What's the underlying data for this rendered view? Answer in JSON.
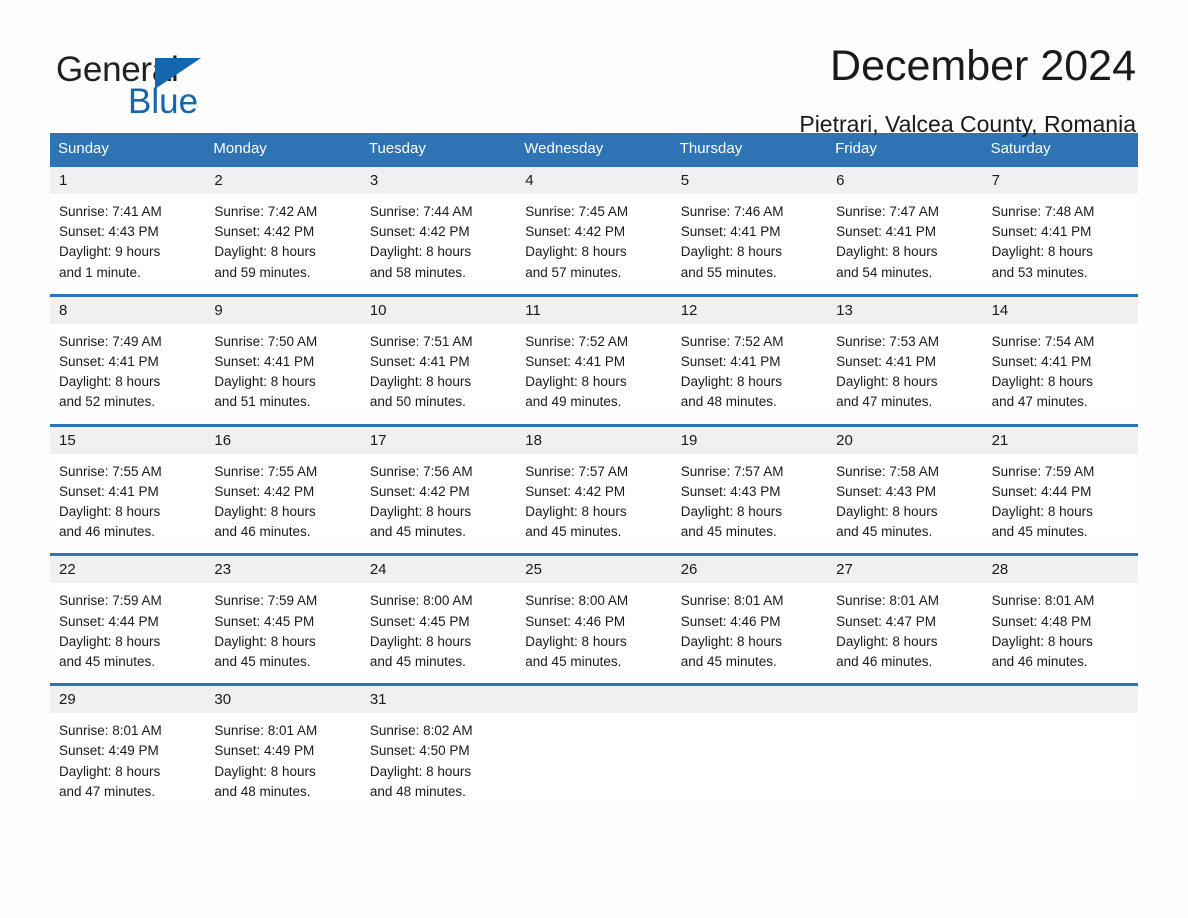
{
  "brand": {
    "name_part1": "General",
    "name_part2": "Blue",
    "triangle_color": "#1567ad",
    "accent_color": "#2e74b5"
  },
  "header": {
    "title": "December 2024",
    "location": "Pietrari, Valcea County, Romania"
  },
  "weekdays": [
    "Sunday",
    "Monday",
    "Tuesday",
    "Wednesday",
    "Thursday",
    "Friday",
    "Saturday"
  ],
  "weeks": [
    [
      {
        "day": "1",
        "lines": [
          "Sunrise: 7:41 AM",
          "Sunset: 4:43 PM",
          "Daylight: 9 hours",
          "and 1 minute."
        ]
      },
      {
        "day": "2",
        "lines": [
          "Sunrise: 7:42 AM",
          "Sunset: 4:42 PM",
          "Daylight: 8 hours",
          "and 59 minutes."
        ]
      },
      {
        "day": "3",
        "lines": [
          "Sunrise: 7:44 AM",
          "Sunset: 4:42 PM",
          "Daylight: 8 hours",
          "and 58 minutes."
        ]
      },
      {
        "day": "4",
        "lines": [
          "Sunrise: 7:45 AM",
          "Sunset: 4:42 PM",
          "Daylight: 8 hours",
          "and 57 minutes."
        ]
      },
      {
        "day": "5",
        "lines": [
          "Sunrise: 7:46 AM",
          "Sunset: 4:41 PM",
          "Daylight: 8 hours",
          "and 55 minutes."
        ]
      },
      {
        "day": "6",
        "lines": [
          "Sunrise: 7:47 AM",
          "Sunset: 4:41 PM",
          "Daylight: 8 hours",
          "and 54 minutes."
        ]
      },
      {
        "day": "7",
        "lines": [
          "Sunrise: 7:48 AM",
          "Sunset: 4:41 PM",
          "Daylight: 8 hours",
          "and 53 minutes."
        ]
      }
    ],
    [
      {
        "day": "8",
        "lines": [
          "Sunrise: 7:49 AM",
          "Sunset: 4:41 PM",
          "Daylight: 8 hours",
          "and 52 minutes."
        ]
      },
      {
        "day": "9",
        "lines": [
          "Sunrise: 7:50 AM",
          "Sunset: 4:41 PM",
          "Daylight: 8 hours",
          "and 51 minutes."
        ]
      },
      {
        "day": "10",
        "lines": [
          "Sunrise: 7:51 AM",
          "Sunset: 4:41 PM",
          "Daylight: 8 hours",
          "and 50 minutes."
        ]
      },
      {
        "day": "11",
        "lines": [
          "Sunrise: 7:52 AM",
          "Sunset: 4:41 PM",
          "Daylight: 8 hours",
          "and 49 minutes."
        ]
      },
      {
        "day": "12",
        "lines": [
          "Sunrise: 7:52 AM",
          "Sunset: 4:41 PM",
          "Daylight: 8 hours",
          "and 48 minutes."
        ]
      },
      {
        "day": "13",
        "lines": [
          "Sunrise: 7:53 AM",
          "Sunset: 4:41 PM",
          "Daylight: 8 hours",
          "and 47 minutes."
        ]
      },
      {
        "day": "14",
        "lines": [
          "Sunrise: 7:54 AM",
          "Sunset: 4:41 PM",
          "Daylight: 8 hours",
          "and 47 minutes."
        ]
      }
    ],
    [
      {
        "day": "15",
        "lines": [
          "Sunrise: 7:55 AM",
          "Sunset: 4:41 PM",
          "Daylight: 8 hours",
          "and 46 minutes."
        ]
      },
      {
        "day": "16",
        "lines": [
          "Sunrise: 7:55 AM",
          "Sunset: 4:42 PM",
          "Daylight: 8 hours",
          "and 46 minutes."
        ]
      },
      {
        "day": "17",
        "lines": [
          "Sunrise: 7:56 AM",
          "Sunset: 4:42 PM",
          "Daylight: 8 hours",
          "and 45 minutes."
        ]
      },
      {
        "day": "18",
        "lines": [
          "Sunrise: 7:57 AM",
          "Sunset: 4:42 PM",
          "Daylight: 8 hours",
          "and 45 minutes."
        ]
      },
      {
        "day": "19",
        "lines": [
          "Sunrise: 7:57 AM",
          "Sunset: 4:43 PM",
          "Daylight: 8 hours",
          "and 45 minutes."
        ]
      },
      {
        "day": "20",
        "lines": [
          "Sunrise: 7:58 AM",
          "Sunset: 4:43 PM",
          "Daylight: 8 hours",
          "and 45 minutes."
        ]
      },
      {
        "day": "21",
        "lines": [
          "Sunrise: 7:59 AM",
          "Sunset: 4:44 PM",
          "Daylight: 8 hours",
          "and 45 minutes."
        ]
      }
    ],
    [
      {
        "day": "22",
        "lines": [
          "Sunrise: 7:59 AM",
          "Sunset: 4:44 PM",
          "Daylight: 8 hours",
          "and 45 minutes."
        ]
      },
      {
        "day": "23",
        "lines": [
          "Sunrise: 7:59 AM",
          "Sunset: 4:45 PM",
          "Daylight: 8 hours",
          "and 45 minutes."
        ]
      },
      {
        "day": "24",
        "lines": [
          "Sunrise: 8:00 AM",
          "Sunset: 4:45 PM",
          "Daylight: 8 hours",
          "and 45 minutes."
        ]
      },
      {
        "day": "25",
        "lines": [
          "Sunrise: 8:00 AM",
          "Sunset: 4:46 PM",
          "Daylight: 8 hours",
          "and 45 minutes."
        ]
      },
      {
        "day": "26",
        "lines": [
          "Sunrise: 8:01 AM",
          "Sunset: 4:46 PM",
          "Daylight: 8 hours",
          "and 45 minutes."
        ]
      },
      {
        "day": "27",
        "lines": [
          "Sunrise: 8:01 AM",
          "Sunset: 4:47 PM",
          "Daylight: 8 hours",
          "and 46 minutes."
        ]
      },
      {
        "day": "28",
        "lines": [
          "Sunrise: 8:01 AM",
          "Sunset: 4:48 PM",
          "Daylight: 8 hours",
          "and 46 minutes."
        ]
      }
    ],
    [
      {
        "day": "29",
        "lines": [
          "Sunrise: 8:01 AM",
          "Sunset: 4:49 PM",
          "Daylight: 8 hours",
          "and 47 minutes."
        ]
      },
      {
        "day": "30",
        "lines": [
          "Sunrise: 8:01 AM",
          "Sunset: 4:49 PM",
          "Daylight: 8 hours",
          "and 48 minutes."
        ]
      },
      {
        "day": "31",
        "lines": [
          "Sunrise: 8:02 AM",
          "Sunset: 4:50 PM",
          "Daylight: 8 hours",
          "and 48 minutes."
        ]
      },
      {
        "day": "",
        "lines": []
      },
      {
        "day": "",
        "lines": []
      },
      {
        "day": "",
        "lines": []
      },
      {
        "day": "",
        "lines": []
      }
    ]
  ]
}
